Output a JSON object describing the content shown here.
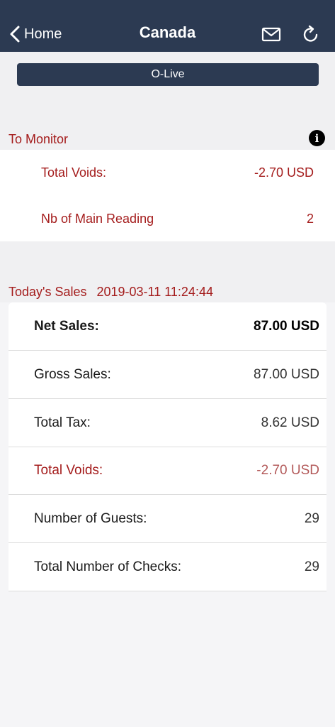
{
  "nav": {
    "back_label": "Home",
    "title": "Canada",
    "mail_icon": "mail-icon",
    "refresh_icon": "refresh-icon"
  },
  "status_bar_label": "O-Live",
  "monitor": {
    "header": "To Monitor",
    "info_icon": "info-icon",
    "rows": [
      {
        "label": "Total Voids:",
        "value": "-2.70 USD"
      },
      {
        "label": "Nb of Main Reading",
        "value": "2"
      }
    ]
  },
  "sales": {
    "header": "Today's Sales",
    "datetime": "2019-03-11 11:24:44",
    "rows": [
      {
        "label": "Net Sales:",
        "value": "87.00 USD",
        "style": "bold"
      },
      {
        "label": "Gross Sales:",
        "value": "87.00 USD",
        "style": "normal"
      },
      {
        "label": "Total Tax:",
        "value": "8.62 USD",
        "style": "normal"
      },
      {
        "label": "Total Voids:",
        "value": "-2.70 USD",
        "style": "red"
      },
      {
        "label": "Number of Guests:",
        "value": "29",
        "style": "normal"
      },
      {
        "label": "Total Number of Checks:",
        "value": "29",
        "style": "normal"
      }
    ]
  },
  "colors": {
    "navbar": "#2c3a52",
    "accent_red": "#a41c1c",
    "background": "#f5f5f7"
  }
}
